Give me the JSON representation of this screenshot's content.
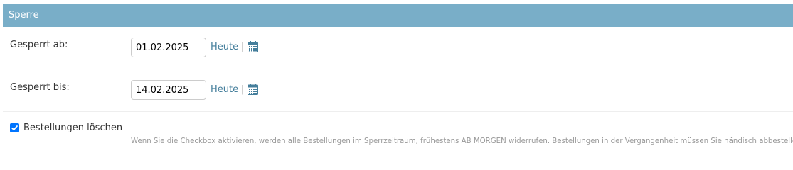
{
  "fieldset": {
    "title": "Sperre"
  },
  "blocked_from": {
    "label": "Gesperrt ab:",
    "value": "01.02.2025",
    "today_label": "Heute",
    "separator": "|",
    "calendar_icon": "calendar-icon"
  },
  "blocked_to": {
    "label": "Gesperrt bis:",
    "value": "14.02.2025",
    "today_label": "Heute",
    "separator": "|",
    "calendar_icon": "calendar-icon"
  },
  "delete_orders": {
    "label": "Bestellungen löschen",
    "checked": true,
    "help": "Wenn Sie die Checkbox aktivieren, werden alle Bestellungen im Sperrzeitraum, frühestens AB MORGEN widerrufen. Bestellungen in der Vergangenheit müssen Sie händisch abbestellen."
  },
  "colors": {
    "header_bg": "#79aec8",
    "link": "#447e9b",
    "checkbox": "#0075ff"
  }
}
